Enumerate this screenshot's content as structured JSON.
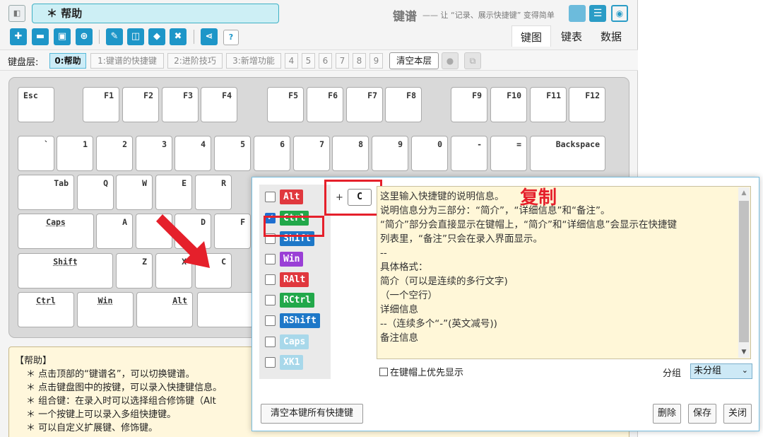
{
  "header": {
    "back_icon": "back-icon",
    "title": "＊ 帮助",
    "app_name": "键谱",
    "tagline": "—— 让 “记录、展示快捷键” 变得简单",
    "mode_icons": [
      "layout-icon",
      "list-icon",
      "screenshot-icon"
    ]
  },
  "toolbar": {
    "icons": [
      "new-file-icon",
      "open-folder-icon",
      "save-icon",
      "save-as-icon",
      "edit-keymap-icon",
      "split-icon",
      "eraser-icon",
      "delete-icon",
      "share-icon",
      "help-icon"
    ],
    "help_label": "?"
  },
  "tabs": [
    "键图",
    "键表",
    "数据"
  ],
  "layers": {
    "label": "键盘层:",
    "items": [
      "0:帮助",
      "1:键谱的快捷键",
      "2:进阶技巧",
      "3:新增功能",
      "4",
      "5",
      "6",
      "7",
      "8",
      "9"
    ],
    "active": 0,
    "clear_label": "清空本层",
    "extra_icons": [
      "apple-icon",
      "window-icon"
    ]
  },
  "keyboard": {
    "row0": [
      "Esc",
      "F1",
      "F2",
      "F3",
      "F4",
      "F5",
      "F6",
      "F7",
      "F8",
      "F9",
      "F10",
      "F11",
      "F12"
    ],
    "row1": [
      "`",
      "1",
      "2",
      "3",
      "4",
      "5",
      "6",
      "7",
      "8",
      "9",
      "0",
      "-",
      "=",
      "Backspace"
    ],
    "row2": [
      "Tab",
      "Q",
      "W",
      "E",
      "R"
    ],
    "row3": [
      "Caps",
      "A",
      "S",
      "D",
      "F"
    ],
    "row4": [
      "Shift",
      "Z",
      "X",
      "C"
    ],
    "row5": [
      "Ctrl",
      "Win",
      "Alt"
    ]
  },
  "help": {
    "title": "【帮助】",
    "lines": [
      "＊ 点击顶部的“键谱名”，可以切换键谱。",
      "＊ 点击键盘图中的按键，可以录入快捷键信息。",
      "＊ 组合键：在录入时可以选择组合修饰键（Alt",
      "＊ 一个按键上可以录入多组快捷键。",
      "＊ 可以自定义扩展键、修饰键。"
    ]
  },
  "dialog": {
    "modifiers": [
      {
        "label": "Alt",
        "checked": false,
        "color": "#e0383e"
      },
      {
        "label": "Ctrl",
        "checked": true,
        "color": "#22a84a"
      },
      {
        "label": "Shift",
        "checked": false,
        "color": "#1e78c8"
      },
      {
        "label": "Win",
        "checked": false,
        "color": "#9a3fd6"
      },
      {
        "label": "RAlt",
        "checked": false,
        "color": "#e0383e"
      },
      {
        "label": "RCtrl",
        "checked": false,
        "color": "#22a84a"
      },
      {
        "label": "RShift",
        "checked": false,
        "color": "#1e78c8"
      },
      {
        "label": "Caps",
        "checked": false,
        "color": "#a8d8ea"
      },
      {
        "label": "XK1",
        "checked": false,
        "color": "#a8d8ea"
      }
    ],
    "plus": "+",
    "key": "C",
    "annotation": "复制",
    "description_lines": [
      "这里输入快捷键的说明信息。",
      "",
      "说明信息分为三部分：“简介”，“详细信息”和“备注”。",
      "“简介”部分会直接显示在键帽上，“简介”和“详细信息”会显示在快捷键",
      "列表里，“备注”只会在录入界面显示。",
      "--",
      "具体格式：",
      "简介（可以是连续的多行文字)",
      "（一个空行）",
      "详细信息",
      "--（连续多个“-”(英文减号))",
      "备注信息"
    ],
    "priority_label": "在键帽上优先显示",
    "group_label": "分组",
    "group_value": "未分组",
    "clear_all_label": "清空本键所有快捷键",
    "delete_label": "删除",
    "save_label": "保存",
    "close_label": "关闭"
  }
}
